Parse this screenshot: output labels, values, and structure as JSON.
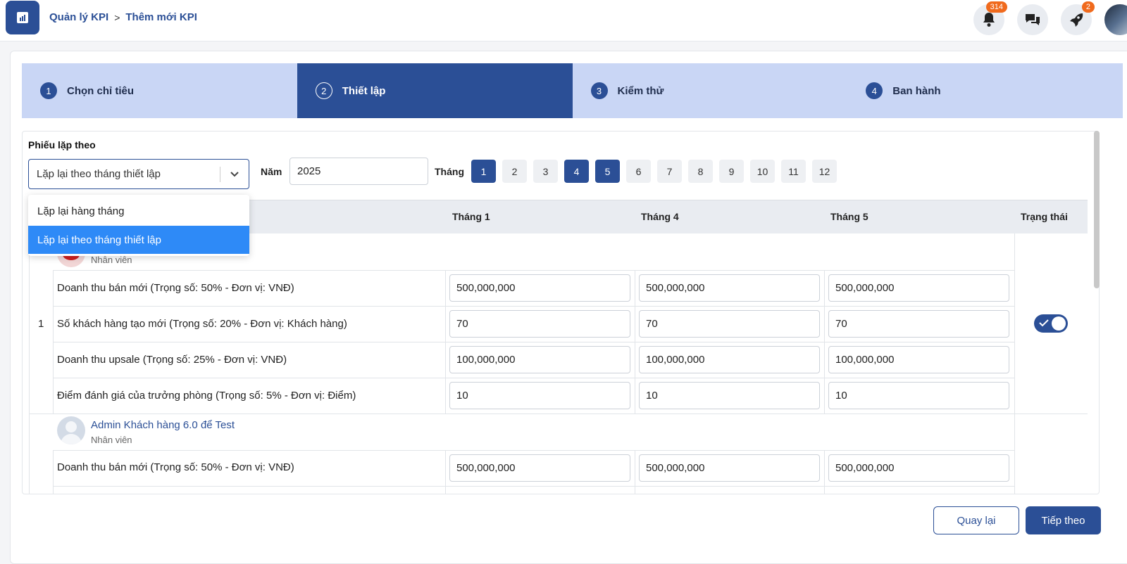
{
  "header": {
    "breadcrumb_root": "Quản lý KPI",
    "breadcrumb_current": "Thêm mới KPI",
    "notif_count": "314",
    "rocket_count": "2",
    "icons": [
      "chart-icon",
      "bell-icon",
      "chat-icon",
      "rocket-icon"
    ]
  },
  "steps": [
    {
      "num": "1",
      "label": "Chọn chỉ tiêu"
    },
    {
      "num": "2",
      "label": "Thiết lập"
    },
    {
      "num": "3",
      "label": "Kiểm thử"
    },
    {
      "num": "4",
      "label": "Ban hành"
    }
  ],
  "form": {
    "phieu_label": "Phiếu lặp theo",
    "select_value": "Lặp lại theo tháng thiết lập",
    "year_label": "Năm",
    "year_value": "2025",
    "month_label": "Tháng",
    "months": [
      "1",
      "2",
      "3",
      "4",
      "5",
      "6",
      "7",
      "8",
      "9",
      "10",
      "11",
      "12"
    ],
    "selected_months": [
      "1",
      "4",
      "5"
    ]
  },
  "dropdown": {
    "options": [
      "Lặp lại hàng tháng",
      "Lặp lại theo tháng thiết lập"
    ],
    "selected": "Lặp lại theo tháng thiết lập"
  },
  "table": {
    "columns": [
      "Tháng 1",
      "Tháng 4",
      "Tháng 5",
      "Trạng thái"
    ],
    "groups": [
      {
        "index": "1",
        "employee_name": "",
        "employee_role": "Nhân viên",
        "status_on": true,
        "rows": [
          {
            "metric": "Doanh thu bán mới (Trọng số: 50% - Đơn vị: VNĐ)",
            "values": [
              "500,000,000",
              "500,000,000",
              "500,000,000"
            ]
          },
          {
            "metric": "Số khách hàng tạo mới (Trọng số: 20% - Đơn vị: Khách hàng)",
            "values": [
              "70",
              "70",
              "70"
            ]
          },
          {
            "metric": "Doanh thu upsale (Trọng số: 25% - Đơn vị: VNĐ)",
            "values": [
              "100,000,000",
              "100,000,000",
              "100,000,000"
            ]
          },
          {
            "metric": "Điểm đánh giá của trưởng phòng (Trọng số: 5% - Đơn vị: Điểm)",
            "values": [
              "10",
              "10",
              "10"
            ]
          }
        ]
      },
      {
        "index": "",
        "employee_name": "Admin Khách hàng 6.0 để Test",
        "employee_role": "Nhân viên",
        "rows": [
          {
            "metric": "Doanh thu bán mới (Trọng số: 50% - Đơn vị: VNĐ)",
            "values": [
              "500,000,000",
              "500,000,000",
              "500,000,000"
            ]
          }
        ]
      }
    ]
  },
  "buttons": {
    "back": "Quay lại",
    "next": "Tiếp theo"
  },
  "colors": {
    "primary": "#2b4f96",
    "step_inactive": "#c9d6f5",
    "dropdown_selected": "#2e8af7",
    "badge": "#f06a1d"
  }
}
